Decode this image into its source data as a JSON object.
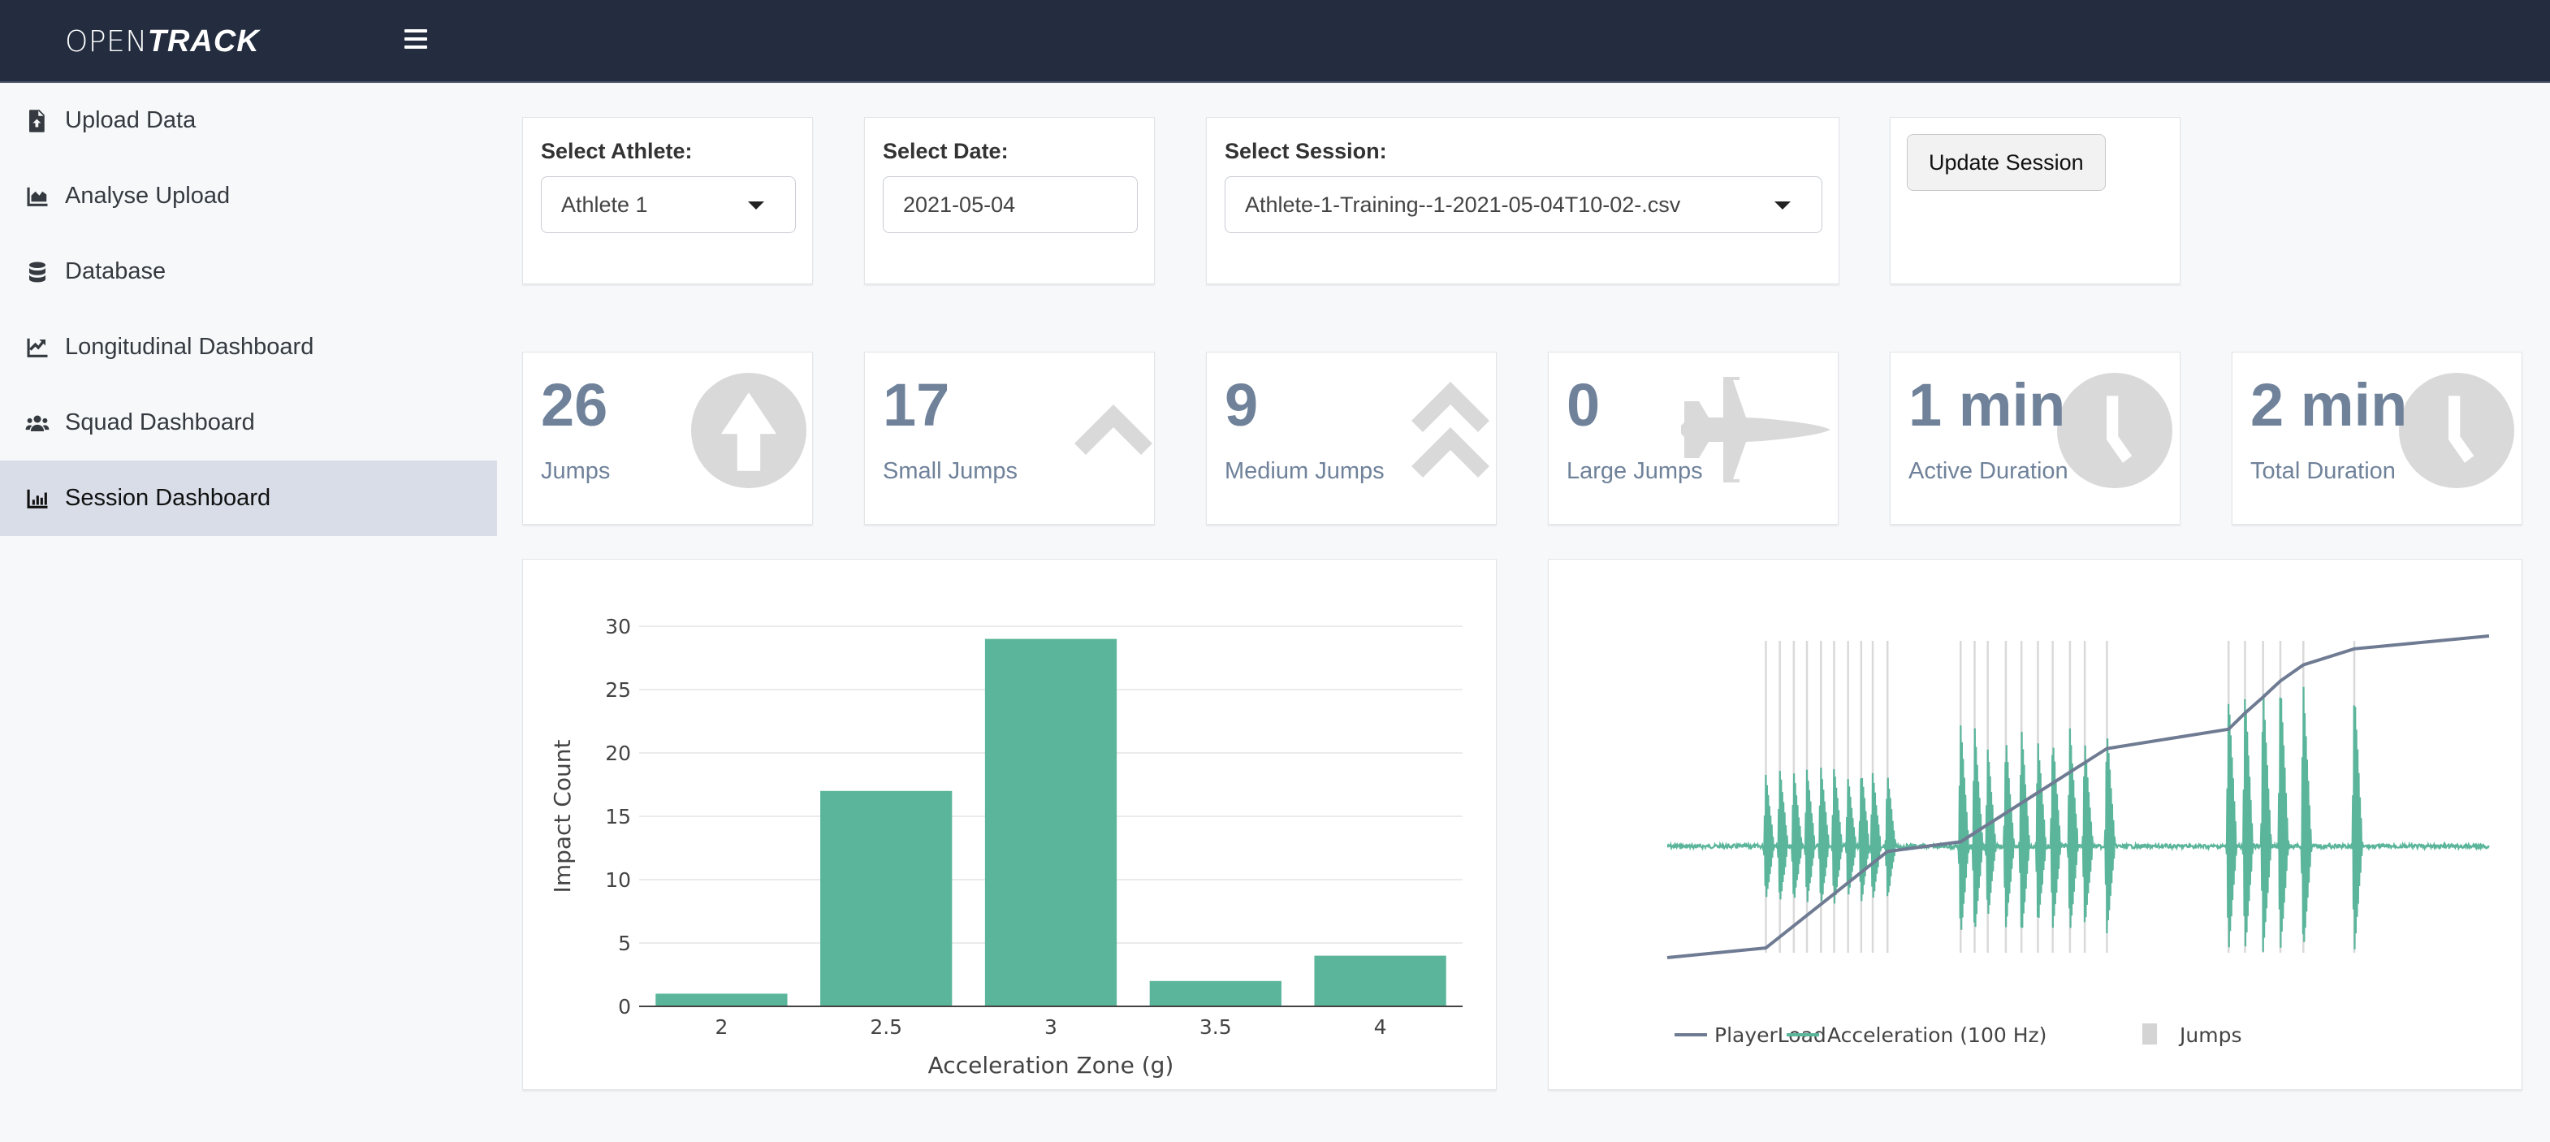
{
  "header": {
    "brand_thin": "OPEN",
    "brand_bold": "TRACK",
    "menu_icon": "hamburger-icon"
  },
  "sidebar": {
    "items": [
      {
        "label": "Upload Data",
        "icon": "file-upload-icon",
        "active": false
      },
      {
        "label": "Analyse Upload",
        "icon": "area-chart-icon",
        "active": false
      },
      {
        "label": "Database",
        "icon": "database-icon",
        "active": false
      },
      {
        "label": "Longitudinal Dashboard",
        "icon": "line-chart-icon",
        "active": false
      },
      {
        "label": "Squad Dashboard",
        "icon": "users-icon",
        "active": false
      },
      {
        "label": "Session Dashboard",
        "icon": "bar-chart-icon",
        "active": true
      }
    ]
  },
  "filters": {
    "athlete": {
      "label": "Select Athlete:",
      "value": "Athlete 1"
    },
    "date": {
      "label": "Select Date:",
      "value": "2021-05-04"
    },
    "session": {
      "label": "Select Session:",
      "value": "Athlete-1-Training--1-2021-05-04T10-02-.csv"
    },
    "update_button": "Update Session"
  },
  "value_boxes": [
    {
      "value": "26",
      "label": "Jumps",
      "icon": "arrow-circle-up-icon"
    },
    {
      "value": "17",
      "label": "Small Jumps",
      "icon": "chevron-up-icon"
    },
    {
      "value": "9",
      "label": "Medium Jumps",
      "icon": "double-chevron-up-icon"
    },
    {
      "value": "0",
      "label": "Large Jumps",
      "icon": "fighter-jet-icon"
    },
    {
      "value": "1 min",
      "label": "Active Duration",
      "icon": "clock-icon"
    },
    {
      "value": "2 min",
      "label": "Total Duration",
      "icon": "clock-icon"
    }
  ],
  "colors": {
    "accent_green": "#5ab59b",
    "playerload": "#6f7b92",
    "jump_line": "#d9d9d9",
    "value_text": "#6f829a",
    "header_bg": "#232d3f"
  },
  "chart_data": [
    {
      "type": "bar",
      "title": "",
      "xlabel": "Acceleration Zone (g)",
      "ylabel": "Impact Count",
      "categories": [
        "2",
        "2.5",
        "3",
        "3.5",
        "4"
      ],
      "values": [
        1,
        17,
        29,
        2,
        4
      ],
      "yticks": [
        0,
        5,
        10,
        15,
        20,
        25,
        30
      ],
      "ylim": [
        0,
        30.5
      ],
      "grid": true,
      "color": "#5ab59b"
    },
    {
      "type": "line",
      "title": "",
      "xlabel": "",
      "ylabel": "",
      "axes_visible": false,
      "legend": {
        "position": "bottom-left",
        "entries": [
          "PlayerLoad",
          "Acceleration (100 Hz)",
          "Jumps"
        ]
      },
      "x_range": [
        0,
        100
      ],
      "jumps_x": [
        12.0,
        13.7,
        15.4,
        17.0,
        18.7,
        20.3,
        22.0,
        23.6,
        25.0,
        26.8,
        35.7,
        37.4,
        39.0,
        41.2,
        43.1,
        45.1,
        46.9,
        49.0,
        50.8,
        53.5,
        68.3,
        70.3,
        72.5,
        74.6,
        77.4,
        83.6
      ],
      "series": [
        {
          "name": "PlayerLoad",
          "note": "cumulative, normalized 0-1",
          "points": [
            [
              0,
              0
            ],
            [
              12.0,
              0.03
            ],
            [
              26.8,
              0.33
            ],
            [
              35.7,
              0.36
            ],
            [
              53.5,
              0.65
            ],
            [
              68.3,
              0.71
            ],
            [
              70.3,
              0.76
            ],
            [
              72.5,
              0.81
            ],
            [
              74.6,
              0.86
            ],
            [
              77.4,
              0.91
            ],
            [
              83.6,
              0.96
            ],
            [
              100,
              1.0
            ]
          ]
        },
        {
          "name": "Acceleration (100 Hz)",
          "note": "baseline ~0.5 (normalized); bursts at each jump",
          "burst_peaks_normalized": [
            0.72,
            0.74,
            0.73,
            0.74,
            0.75,
            0.75,
            0.71,
            0.74,
            0.73,
            0.72,
            0.88,
            0.87,
            0.8,
            0.84,
            0.87,
            0.83,
            0.84,
            0.86,
            0.83,
            0.86,
            0.97,
            0.98,
            1.0,
            1.02,
            1.0,
            0.99
          ]
        }
      ]
    }
  ]
}
